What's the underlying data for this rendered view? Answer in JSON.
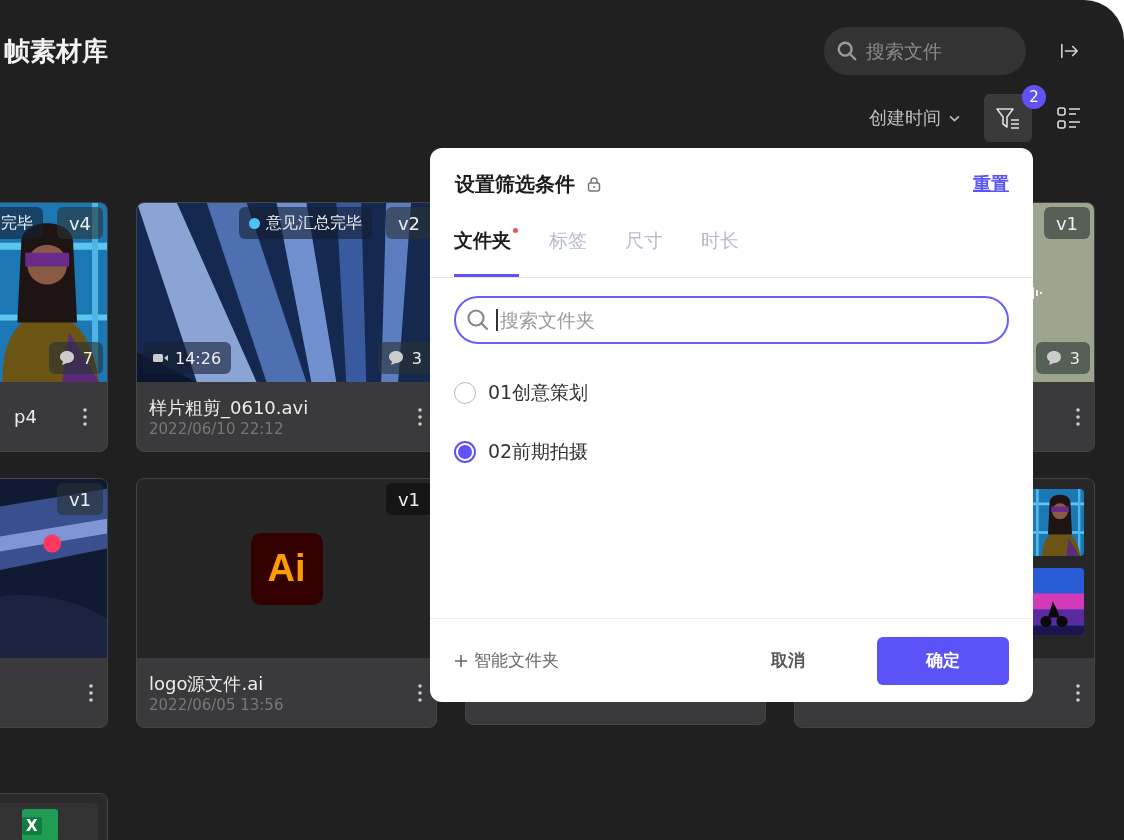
{
  "header": {
    "title": "帧素材库",
    "search": {
      "placeholder": "搜索文件"
    },
    "sort": {
      "label": "创建时间"
    },
    "filter_count": "2"
  },
  "cards": [
    {
      "kind": "media",
      "status": {
        "text": "完毕"
      },
      "version": "v4",
      "comments": "7",
      "name": "p4",
      "menu": true
    },
    {
      "kind": "media",
      "status": {
        "text": "意见汇总完毕",
        "color": "#4cc3f5"
      },
      "version": "v2",
      "duration": "14:26",
      "comments": "3",
      "name": "样片粗剪_0610.avi",
      "date": "2022/06/10 22:12",
      "menu": true
    },
    {
      "kind": "covered"
    },
    {
      "kind": "audio",
      "version": "v1",
      "comments": "3",
      "menu": true
    },
    {
      "kind": "media",
      "version": "v1",
      "menu": true
    },
    {
      "kind": "ai",
      "logo": "Ai",
      "version": "v1",
      "name": "logo源文件.ai",
      "date": "2022/06/05 13:56",
      "menu": true
    },
    {
      "kind": "blank"
    },
    {
      "kind": "collage",
      "menu": true
    },
    {
      "kind": "excel",
      "logo": "X"
    }
  ],
  "filter_panel": {
    "title": "设置筛选条件",
    "reset": "重置",
    "tabs": [
      {
        "label": "文件夹",
        "selected": true,
        "dot": true
      },
      {
        "label": "标签",
        "selected": false,
        "dot": false
      },
      {
        "label": "尺寸",
        "selected": false,
        "dot": false
      },
      {
        "label": "时长",
        "selected": false,
        "dot": false
      }
    ],
    "search": {
      "placeholder": "搜索文件夹"
    },
    "folders": [
      {
        "label": "01创意策划",
        "selected": false
      },
      {
        "label": "02前期拍摄",
        "selected": true
      }
    ],
    "add": "智能文件夹",
    "cancel": "取消",
    "confirm": "确定"
  }
}
